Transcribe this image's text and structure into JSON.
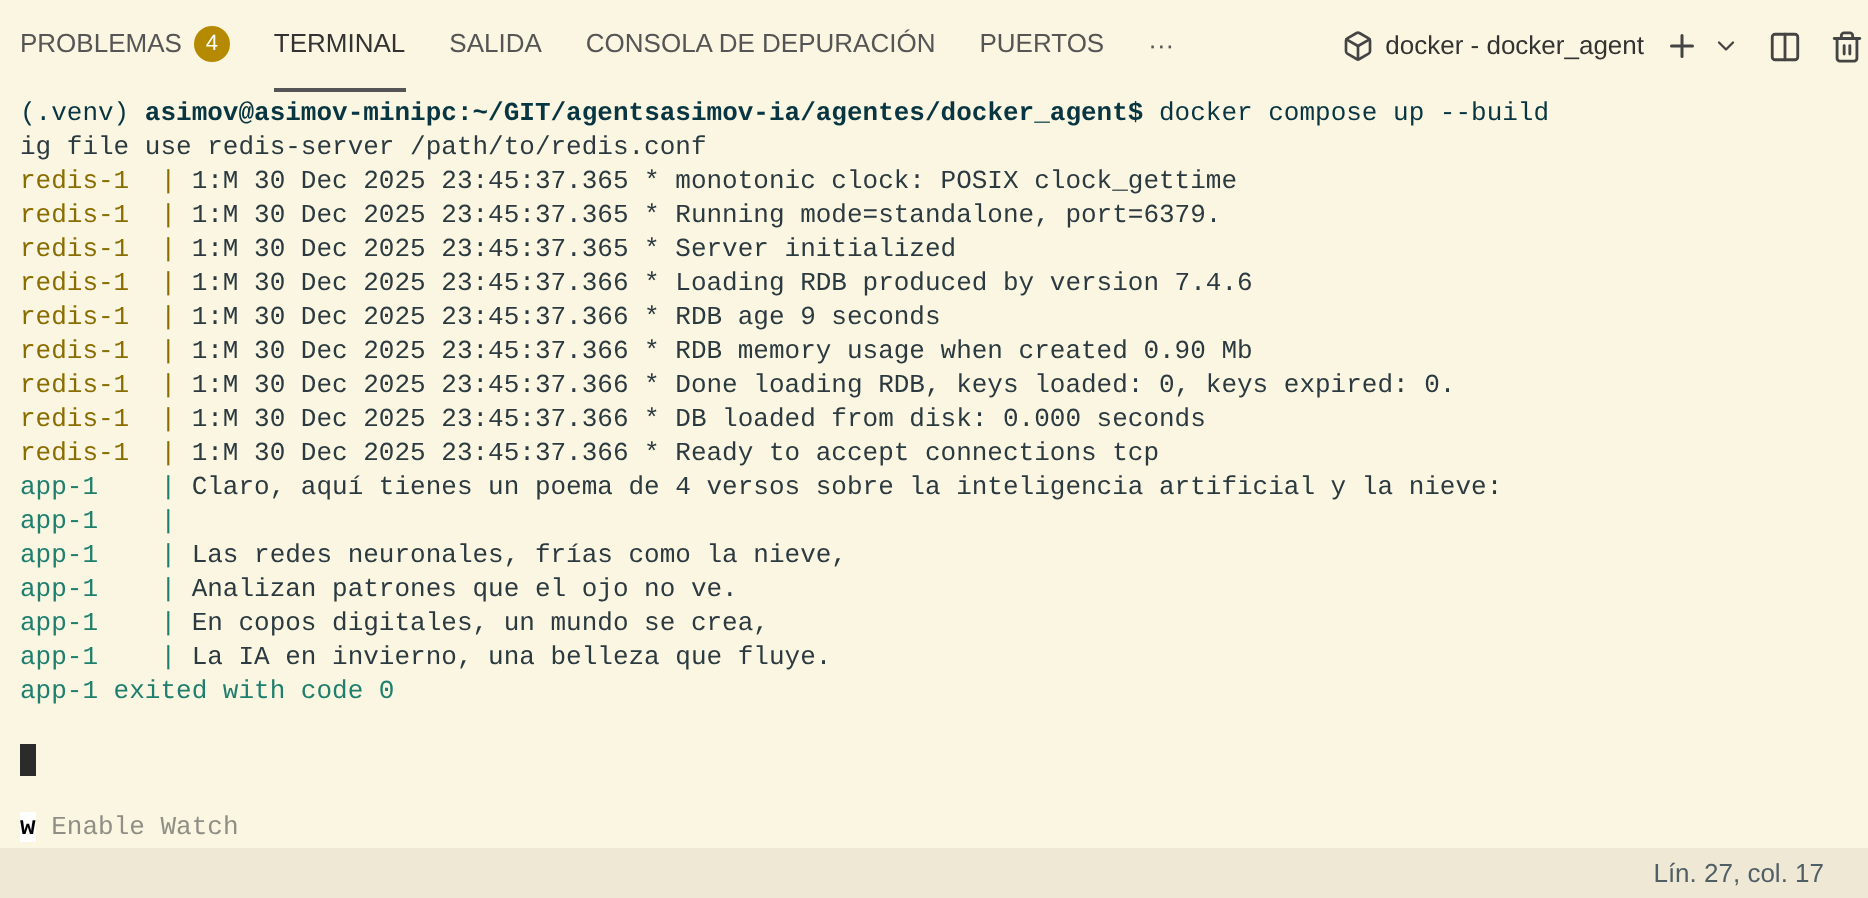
{
  "panel_tabs": [
    {
      "label": "PROBLEMAS",
      "badge": "4",
      "selected": false
    },
    {
      "label": "TERMINAL",
      "selected": true
    },
    {
      "label": "SALIDA",
      "selected": false
    },
    {
      "label": "CONSOLA DE DEPURACIÓN",
      "selected": false
    },
    {
      "label": "PUERTOS",
      "selected": false
    }
  ],
  "more_button": "···",
  "terminal_name": "docker - docker_agent",
  "terminal_lines": [
    {
      "kind": "prompt",
      "text": "(.venv) **asimov@asimov-minipc:~/GIT/agentsasimov-ia/agentes/docker_agent$** docker compose up --build"
    },
    {
      "kind": "plain",
      "text": "ig file use redis-server /path/to/redis.conf"
    },
    {
      "kind": "log",
      "prefix": "redis-1  |",
      "color": "#8a6d00",
      "text": " 1:M 30 Dec 2025 23:45:37.365 * monotonic clock: POSIX clock_gettime"
    },
    {
      "kind": "log",
      "prefix": "redis-1  |",
      "color": "#8a6d00",
      "text": " 1:M 30 Dec 2025 23:45:37.365 * Running mode=standalone, port=6379."
    },
    {
      "kind": "log",
      "prefix": "redis-1  |",
      "color": "#8a6d00",
      "text": " 1:M 30 Dec 2025 23:45:37.365 * Server initialized"
    },
    {
      "kind": "log",
      "prefix": "redis-1  |",
      "color": "#8a6d00",
      "text": " 1:M 30 Dec 2025 23:45:37.366 * Loading RDB produced by version 7.4.6"
    },
    {
      "kind": "log",
      "prefix": "redis-1  |",
      "color": "#8a6d00",
      "text": " 1:M 30 Dec 2025 23:45:37.366 * RDB age 9 seconds"
    },
    {
      "kind": "log",
      "prefix": "redis-1  |",
      "color": "#8a6d00",
      "text": " 1:M 30 Dec 2025 23:45:37.366 * RDB memory usage when created 0.90 Mb"
    },
    {
      "kind": "log",
      "prefix": "redis-1  |",
      "color": "#8a6d00",
      "text": " 1:M 30 Dec 2025 23:45:37.366 * Done loading RDB, keys loaded: 0, keys expired: 0."
    },
    {
      "kind": "log",
      "prefix": "redis-1  |",
      "color": "#8a6d00",
      "text": " 1:M 30 Dec 2025 23:45:37.366 * DB loaded from disk: 0.000 seconds"
    },
    {
      "kind": "log",
      "prefix": "redis-1  |",
      "color": "#8a6d00",
      "text": " 1:M 30 Dec 2025 23:45:37.366 * Ready to accept connections tcp"
    },
    {
      "kind": "log",
      "prefix": "app-1    |",
      "color": "#1e7f6e",
      "text": " Claro, aquí tienes un poema de 4 versos sobre la inteligencia artificial y la nieve:"
    },
    {
      "kind": "log",
      "prefix": "app-1    |",
      "color": "#1e7f6e"
    },
    {
      "kind": "log",
      "prefix": "app-1    |",
      "color": "#1e7f6e",
      "text": " Las redes neuronales, frías como la nieve,"
    },
    {
      "kind": "log",
      "prefix": "app-1    |",
      "color": "#1e7f6e",
      "text": " Analizan patrones que el ojo no ve."
    },
    {
      "kind": "log",
      "prefix": "app-1    |",
      "color": "#1e7f6e",
      "text": " En copos digitales, un mundo se crea,"
    },
    {
      "kind": "log",
      "prefix": "app-1    |",
      "color": "#1e7f6e",
      "text": " La IA en invierno, una belleza que fluye."
    },
    {
      "kind": "status",
      "color": "#1e7f6e",
      "text": "app-1 exited with code 0"
    },
    {
      "kind": "blank"
    },
    {
      "kind": "cursor"
    },
    {
      "kind": "blank"
    },
    {
      "kind": "hint",
      "key": "w",
      "text": "Enable Watch"
    }
  ],
  "status_bar": {
    "position": "Lín. 27, col. 17"
  }
}
